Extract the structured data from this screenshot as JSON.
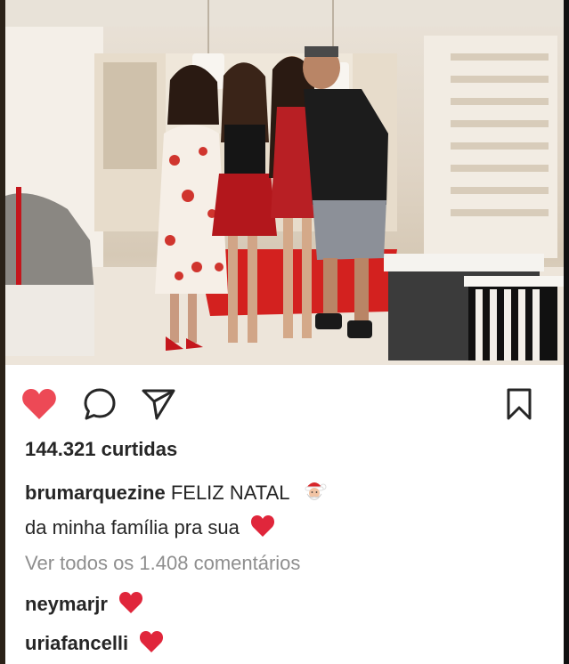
{
  "post": {
    "photo_alt": "",
    "likes_text": "144.321 curtidas",
    "caption": {
      "username": "brumarquezine",
      "line1_text": "FELIZ NATAL",
      "line1_emoji": "santa-emoji",
      "line2_text": "da minha família pra sua",
      "line2_emoji": "red-heart-emoji"
    },
    "view_comments": "Ver todos os 1.408 comentários",
    "comments": [
      {
        "username": "neymarjr",
        "emoji": "red-heart-emoji"
      },
      {
        "username": "uriafancelli",
        "emoji": "red-heart-emoji"
      }
    ],
    "actions": {
      "like_icon": "heart-filled-icon",
      "comment_icon": "comment-bubble-icon",
      "share_icon": "paper-plane-icon",
      "save_icon": "bookmark-icon"
    },
    "colors": {
      "like_red": "#ed4956",
      "muted": "#8e8e8e",
      "text": "#262626"
    }
  }
}
